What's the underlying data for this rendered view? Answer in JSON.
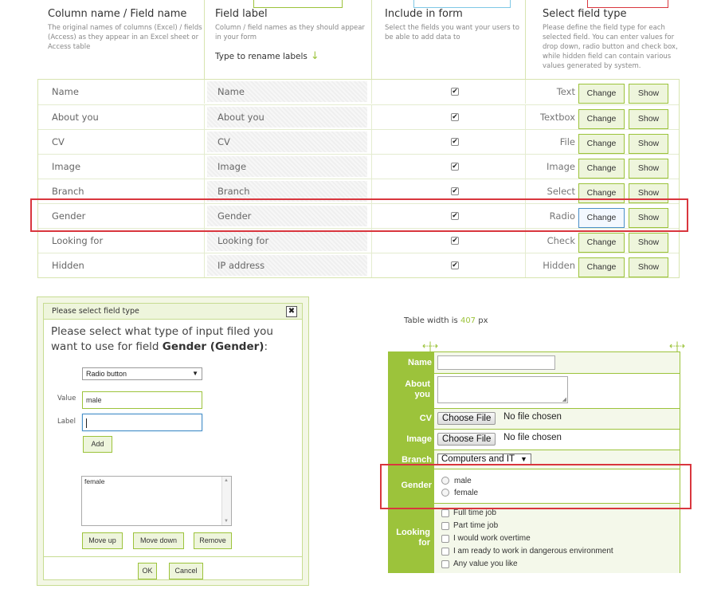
{
  "header": {
    "columns": [
      {
        "title": "Column name / Field name",
        "desc": "The original names of columns (Excel) / fields (Access) as they appear in an Excel sheet or Access table"
      },
      {
        "title": "Field label",
        "desc": "Column / field names as they should appear in your form"
      },
      {
        "title": "Include in form",
        "desc": "Select the fields you want your users to be able to add data to"
      },
      {
        "title": "Select field type",
        "desc": "Please define the field type for each selected field. You can enter values for drop down, radio button and check box, while hidden field can contain various values generated by system."
      }
    ],
    "rename_hint": "Type to rename labels",
    "rename_arrow": "↓"
  },
  "fields": {
    "change_label": "Change",
    "show_label": "Show",
    "rows": [
      {
        "name": "Name",
        "label": "Name",
        "included": true,
        "type": "Text"
      },
      {
        "name": "About you",
        "label": "About you",
        "included": true,
        "type": "Textbox"
      },
      {
        "name": "CV",
        "label": "CV",
        "included": true,
        "type": "File"
      },
      {
        "name": "Image",
        "label": "Image",
        "included": true,
        "type": "Image"
      },
      {
        "name": "Branch",
        "label": "Branch",
        "included": true,
        "type": "Select"
      },
      {
        "name": "Gender",
        "label": "Gender",
        "included": true,
        "type": "Radio"
      },
      {
        "name": "Looking for",
        "label": "Looking for",
        "included": true,
        "type": "Check"
      },
      {
        "name": "Hidden",
        "label": "IP address",
        "included": true,
        "type": "Hidden"
      }
    ]
  },
  "dialog": {
    "title": "Please select field type",
    "close_glyph": "✖",
    "question": "Please select what type of input filed you want to use for field ",
    "field_ref": "Gender (Gender)",
    "question_end": ":",
    "type_select": "Radio button",
    "value_label": "Value",
    "value_input": "male",
    "label_label": "Label",
    "label_input": "",
    "add_button": "Add",
    "list_items": [
      "female"
    ],
    "move_up": "Move up",
    "move_down": "Move down",
    "remove": "Remove",
    "ok": "OK",
    "cancel": "Cancel"
  },
  "preview": {
    "width_prefix": "Table width is ",
    "width_value": "407",
    "width_suffix": " px",
    "resize_glyph": "⇠|⇢",
    "labels": {
      "name": "Name",
      "about": "About you",
      "cv": "CV",
      "image": "Image",
      "branch": "Branch",
      "gender": "Gender",
      "looking": "Looking for"
    },
    "choose_file": "Choose File",
    "no_file": "No file chosen",
    "branch_value": "Computers and IT",
    "gender_options": [
      "male",
      "female"
    ],
    "looking_options": [
      "Full time job",
      "Part time job",
      "I would work overtime",
      "I am ready to work in dangerous environment",
      "Any value you like"
    ]
  },
  "colors": {
    "accent": "#9cc33b",
    "highlight": "#d9363e",
    "active_button": "#4a90c8"
  }
}
